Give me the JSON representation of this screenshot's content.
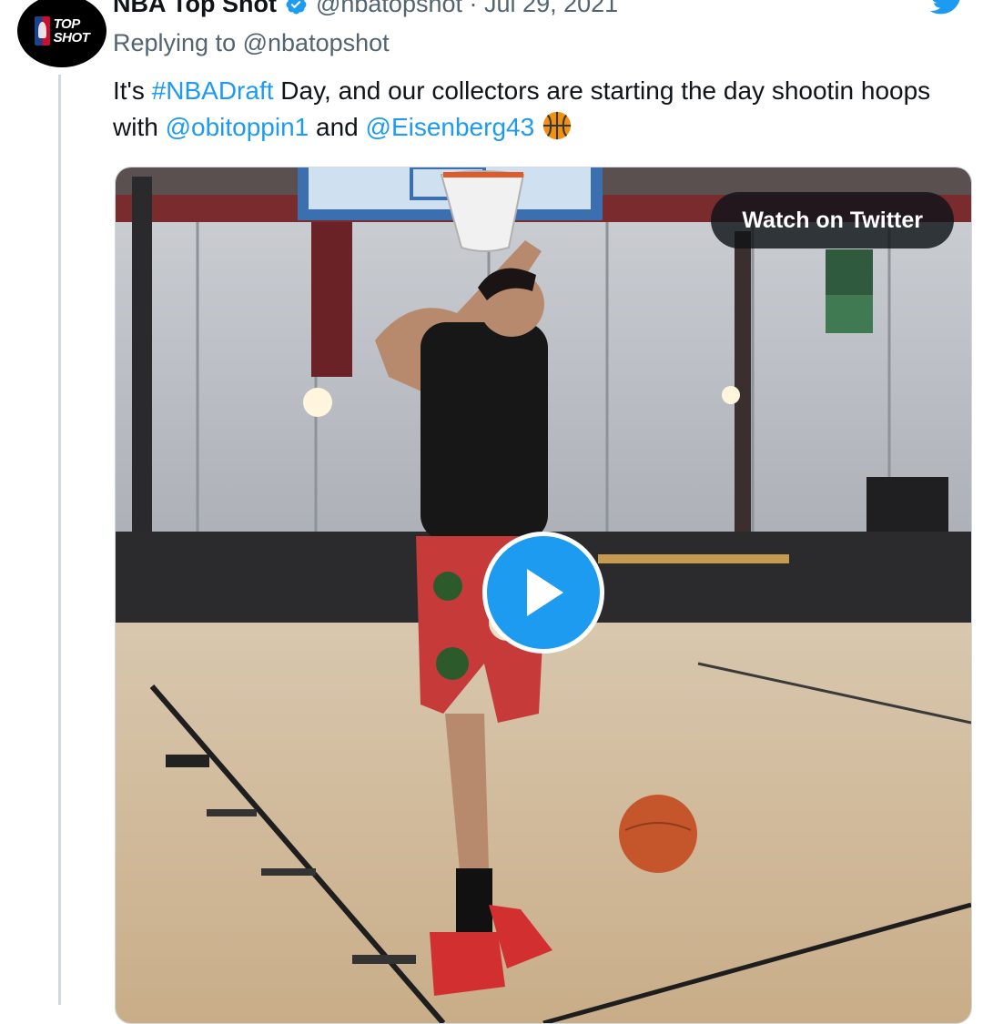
{
  "tweet": {
    "author_name": "NBA Top Shot",
    "author_handle": "@nbatopshot",
    "separator": "·",
    "date": "Jul 29, 2021",
    "avatar_logo_line1": "TOP",
    "avatar_logo_line2": "SHOT",
    "replying_prefix": "Replying to",
    "replying_to": "@nbatopshot",
    "text": {
      "part1": "It's ",
      "hashtag": "#NBADraft",
      "part2": " Day, and our collectors are starting the day shootin hoops with ",
      "mention1": "@obitoppin1",
      "part3": " and ",
      "mention2": "@Eisenberg43",
      "emoji": "basketball"
    }
  },
  "media": {
    "watch_label": "Watch on Twitter",
    "play_icon": "play-icon"
  },
  "colors": {
    "link": "#1d9bf0",
    "secondary_text": "#536471",
    "play_button": "#1d9bf0"
  }
}
